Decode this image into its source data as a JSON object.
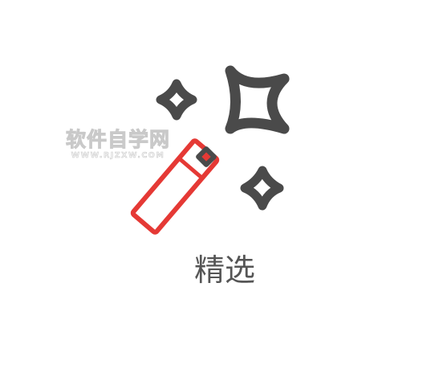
{
  "icon": {
    "name": "magic-wand-sparkles-icon",
    "caption": "精选",
    "colors": {
      "wand": "#e53935",
      "stars": "#4a4a4a",
      "caption": "#555555"
    }
  },
  "watermark": {
    "text": "软件自学网",
    "url": "WWW.RJZXW.COM"
  }
}
